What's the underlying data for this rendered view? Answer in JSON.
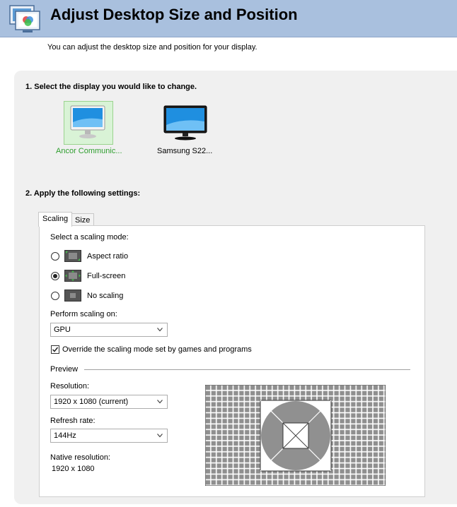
{
  "header": {
    "title": "Adjust Desktop Size and Position",
    "icon": "display-settings-icon"
  },
  "subtitle": "You can adjust the desktop size and position for your display.",
  "section1": {
    "label": "1. Select the display you would like to change.",
    "displays": [
      {
        "label": "Ancor Communic...",
        "selected": true
      },
      {
        "label": "Samsung S22...",
        "selected": false
      }
    ]
  },
  "section2": {
    "label": "2. Apply the following settings:"
  },
  "tabs": [
    {
      "label": "Scaling",
      "active": true
    },
    {
      "label": "Size",
      "active": false
    }
  ],
  "scaling": {
    "mode_label": "Select a scaling mode:",
    "modes": [
      {
        "label": "Aspect ratio",
        "checked": false,
        "icon": "aspect-ratio-icon"
      },
      {
        "label": "Full-screen",
        "checked": true,
        "icon": "full-screen-icon"
      },
      {
        "label": "No scaling",
        "checked": false,
        "icon": "no-scaling-icon"
      }
    ],
    "perform_label": "Perform scaling on:",
    "perform_value": "GPU",
    "override_label": "Override the scaling mode set by games and programs",
    "override_checked": true
  },
  "preview": {
    "label": "Preview",
    "resolution_label": "Resolution:",
    "resolution_value": "1920 x 1080 (current)",
    "refresh_label": "Refresh rate:",
    "refresh_value": "144Hz",
    "native_label": "Native resolution:",
    "native_value": "1920 x 1080"
  },
  "colors": {
    "header_bg": "#a9c0de",
    "selected_label": "#2e9e2e",
    "panel_bg": "#f0f0f0"
  }
}
